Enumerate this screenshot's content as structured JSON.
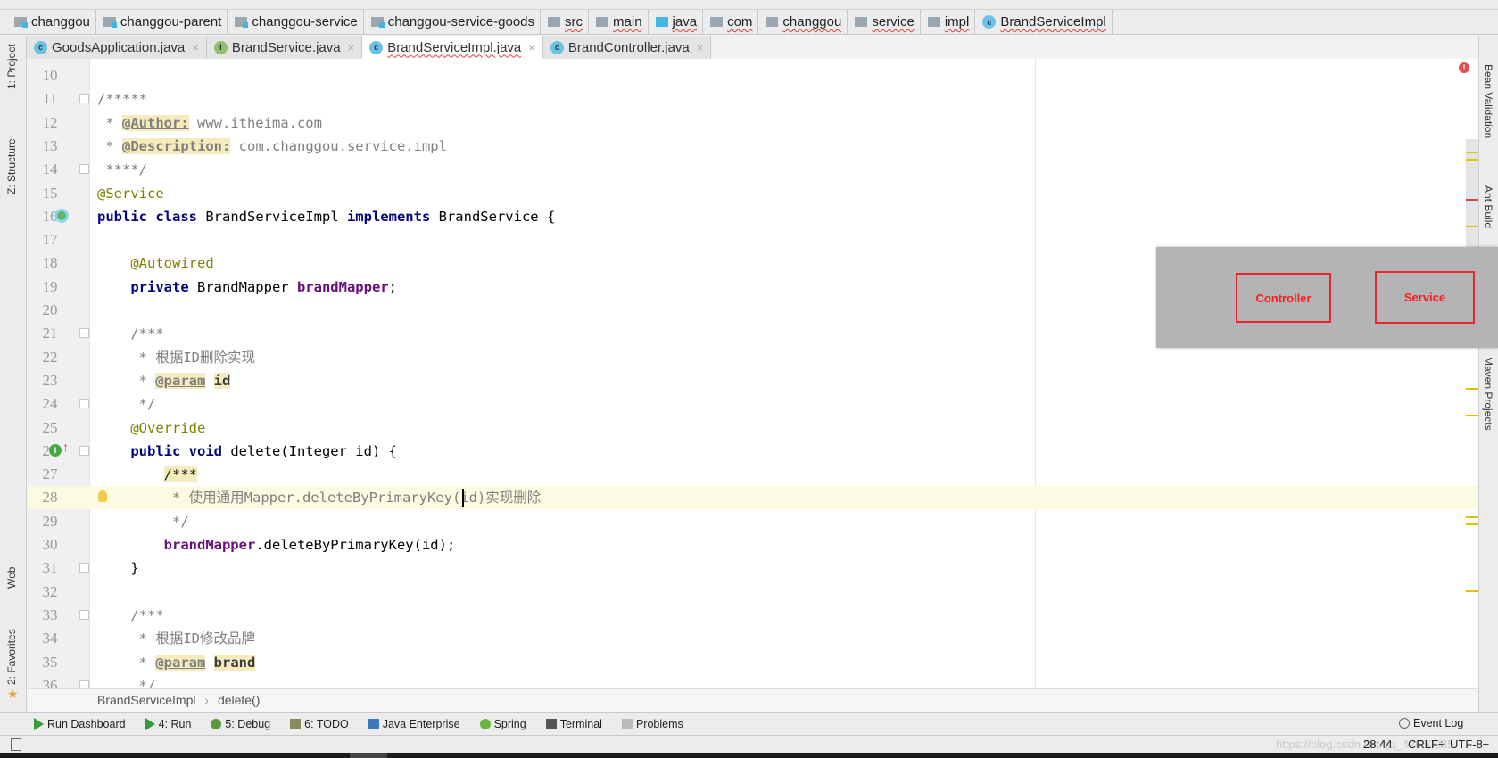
{
  "navbar": {
    "items": [
      {
        "label": "changgou",
        "icon": "module-folder-icon"
      },
      {
        "label": "changgou-parent",
        "icon": "module-folder-icon"
      },
      {
        "label": "changgou-service",
        "icon": "module-folder-icon"
      },
      {
        "label": "changgou-service-goods",
        "icon": "module-folder-icon"
      },
      {
        "label": "src",
        "icon": "folder-icon"
      },
      {
        "label": "main",
        "icon": "folder-icon"
      },
      {
        "label": "java",
        "icon": "source-folder-icon"
      },
      {
        "label": "com",
        "icon": "package-icon"
      },
      {
        "label": "changgou",
        "icon": "package-icon"
      },
      {
        "label": "service",
        "icon": "package-icon"
      },
      {
        "label": "impl",
        "icon": "package-icon"
      },
      {
        "label": "BrandServiceImpl",
        "icon": "class-icon"
      }
    ]
  },
  "tabs": [
    {
      "label": "GoodsApplication.java",
      "icon": "spring-boot-class-icon",
      "active": false
    },
    {
      "label": "BrandService.java",
      "icon": "interface-icon",
      "active": false
    },
    {
      "label": "BrandServiceImpl.java",
      "icon": "class-icon",
      "active": true
    },
    {
      "label": "BrandController.java",
      "icon": "class-icon",
      "active": false
    }
  ],
  "left_tools": [
    "1: Project",
    "Z: Structure",
    "Web",
    "2: Favorites"
  ],
  "right_tools": [
    "Bean Validation",
    "Ant Build",
    "Maven Projects"
  ],
  "editor": {
    "current_line": 28,
    "lines": [
      {
        "n": "10",
        "t": []
      },
      {
        "n": "11",
        "t": [
          [
            "c",
            "/*****"
          ]
        ]
      },
      {
        "n": "12",
        "t": [
          [
            "c",
            " * "
          ],
          [
            "tag",
            "@Author:"
          ],
          [
            "c",
            " www.itheima.com"
          ]
        ]
      },
      {
        "n": "13",
        "t": [
          [
            "c",
            " * "
          ],
          [
            "tag",
            "@Description:"
          ],
          [
            "c",
            " com.changgou.service.impl"
          ]
        ]
      },
      {
        "n": "14",
        "t": [
          [
            "c",
            " ****/"
          ]
        ]
      },
      {
        "n": "15",
        "t": [
          [
            "ann",
            "@Service"
          ]
        ]
      },
      {
        "n": "16",
        "t": [
          [
            "kw",
            "public class "
          ],
          [
            "p",
            "BrandServiceImpl "
          ],
          [
            "kw",
            "implements "
          ],
          [
            "p",
            "BrandService {"
          ]
        ]
      },
      {
        "n": "17",
        "t": []
      },
      {
        "n": "18",
        "t": [
          [
            "ann",
            "    @Autowired"
          ]
        ]
      },
      {
        "n": "19",
        "t": [
          [
            "kw",
            "    private "
          ],
          [
            "p",
            "BrandMapper "
          ],
          [
            "f",
            "brandMapper"
          ],
          [
            "p",
            ";"
          ]
        ]
      },
      {
        "n": "20",
        "t": []
      },
      {
        "n": "21",
        "t": [
          [
            "c",
            "    /***"
          ]
        ]
      },
      {
        "n": "22",
        "t": [
          [
            "c",
            "     * 根据ID删除实现"
          ]
        ]
      },
      {
        "n": "23",
        "t": [
          [
            "c",
            "     * "
          ],
          [
            "tag",
            "@param"
          ],
          [
            "c",
            " "
          ],
          [
            "pn",
            "id"
          ]
        ]
      },
      {
        "n": "24",
        "t": [
          [
            "c",
            "     */"
          ]
        ]
      },
      {
        "n": "25",
        "t": [
          [
            "ann",
            "    @Override"
          ]
        ]
      },
      {
        "n": "26",
        "t": [
          [
            "kw",
            "    public void "
          ],
          [
            "p",
            "delete(Integer id) {"
          ]
        ]
      },
      {
        "n": "27",
        "t": [
          [
            "p",
            "        "
          ],
          [
            "hl",
            "/***"
          ]
        ]
      },
      {
        "n": "28",
        "t": [
          [
            "c",
            "         * 使用通用Mapper.deleteByPrimaryKey(id)实现删除"
          ]
        ]
      },
      {
        "n": "29",
        "t": [
          [
            "c",
            "         */"
          ]
        ]
      },
      {
        "n": "30",
        "t": [
          [
            "f",
            "        brandMapper"
          ],
          [
            "p",
            ".deleteByPrimaryKey(id);"
          ]
        ]
      },
      {
        "n": "31",
        "t": [
          [
            "p",
            "    }"
          ]
        ]
      },
      {
        "n": "32",
        "t": []
      },
      {
        "n": "33",
        "t": [
          [
            "c",
            "    /***"
          ]
        ]
      },
      {
        "n": "34",
        "t": [
          [
            "c",
            "     * 根据ID修改品牌"
          ]
        ]
      },
      {
        "n": "35",
        "t": [
          [
            "c",
            "     * "
          ],
          [
            "tag",
            "@param"
          ],
          [
            "c",
            " "
          ],
          [
            "pn",
            "brand"
          ]
        ]
      },
      {
        "n": "36",
        "t": [
          [
            "c",
            "     */"
          ]
        ]
      }
    ]
  },
  "overlay": {
    "boxes": [
      "Controller",
      "Service"
    ],
    "color": "#e8242c"
  },
  "breadcrumb": {
    "class": "BrandServiceImpl",
    "method": "delete()",
    "sep": "›"
  },
  "tool_windows": [
    {
      "label": "Run Dashboard",
      "icon": "run-icon"
    },
    {
      "label": "4: Run",
      "icon": "run-icon"
    },
    {
      "label": "5: Debug",
      "icon": "debug-icon"
    },
    {
      "label": "6: TODO",
      "icon": "todo-icon"
    },
    {
      "label": "Java Enterprise",
      "icon": "java-enterprise-icon"
    },
    {
      "label": "Spring",
      "icon": "spring-icon"
    },
    {
      "label": "Terminal",
      "icon": "terminal-icon"
    },
    {
      "label": "Problems",
      "icon": "problems-icon"
    }
  ],
  "event_log": "Event Log",
  "status": {
    "position": "28:44",
    "line_sep": "CRLF÷",
    "encoding": "UTF-8÷",
    "watermark": "https://blog.csdn.net/qq_42650085"
  }
}
